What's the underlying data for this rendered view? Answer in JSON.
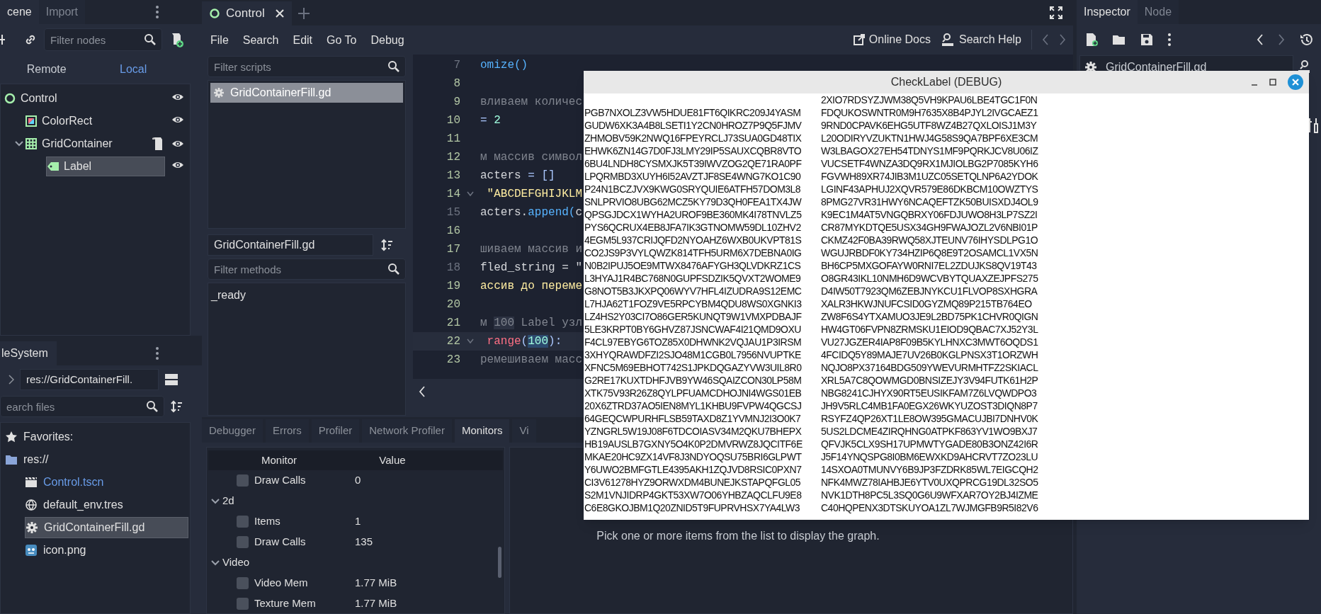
{
  "scene_dock": {
    "tabs": [
      {
        "label": "cene",
        "selected": true
      },
      {
        "label": "Import",
        "selected": false
      }
    ],
    "filter": {
      "placeholder": "Filter nodes"
    },
    "modes": [
      {
        "label": "Remote",
        "selected": false
      },
      {
        "label": "Local",
        "selected": true
      }
    ],
    "tree": [
      {
        "label": "Control",
        "kind": "control",
        "script": false,
        "visible": true,
        "selected": false,
        "children": [
          {
            "label": "ColorRect",
            "kind": "colorrect",
            "script": false,
            "visible": true,
            "selected": false
          },
          {
            "label": "GridContainer",
            "kind": "grid",
            "script": true,
            "visible": true,
            "selected": false,
            "expanded": true,
            "children": [
              {
                "label": "Label",
                "kind": "label",
                "script": false,
                "visible": true,
                "selected": true
              }
            ]
          }
        ]
      }
    ]
  },
  "filesystem": {
    "tab": "leSystem",
    "path": "res://GridContainerFill.",
    "search": {
      "placeholder": "earch files"
    },
    "tree": [
      {
        "label": "Favorites:",
        "kind": "favorites",
        "selected": false,
        "open": false
      },
      {
        "label": "res://",
        "kind": "folder",
        "selected": false,
        "open": false,
        "children": [
          {
            "label": "Control.tscn",
            "kind": "scene",
            "selected": false,
            "open": true
          },
          {
            "label": "default_env.tres",
            "kind": "environment",
            "selected": false,
            "open": false
          },
          {
            "label": "GridContainerFill.gd",
            "kind": "script",
            "selected": true,
            "open": false
          },
          {
            "label": "icon.png",
            "kind": "image",
            "selected": false,
            "open": false
          }
        ]
      }
    ]
  },
  "scene_tabs": [
    {
      "label": "Control",
      "selected": true
    }
  ],
  "menu": [
    "File",
    "Search",
    "Edit",
    "Go To",
    "Debug"
  ],
  "help_links": [
    "Online Docs",
    "Search Help"
  ],
  "script_list": {
    "filter": {
      "placeholder": "Filter scripts"
    },
    "items": [
      {
        "label": "GridContainerFill.gd",
        "selected": true
      }
    ]
  },
  "method_panel": {
    "script_name": "GridContainerFill.gd",
    "filter": {
      "placeholder": "Filter methods"
    },
    "methods": [
      "_ready"
    ]
  },
  "code_lines": [
    {
      "number": "7",
      "safe": false,
      "current": false,
      "segments": [
        {
          "text": "omize()",
          "kind": "func"
        }
      ]
    },
    {
      "number": "8",
      "safe": true,
      "current": false
    },
    {
      "number": "9",
      "safe": true,
      "current": false,
      "segments": [
        {
          "text": "вливаем количес",
          "kind": "comment"
        }
      ]
    },
    {
      "number": "10",
      "safe": true,
      "current": false,
      "segments": [
        {
          "text": "= ",
          "kind": "symbol"
        },
        {
          "text": "2",
          "kind": "number"
        }
      ]
    },
    {
      "number": "11",
      "safe": true,
      "current": false
    },
    {
      "number": "12",
      "safe": true,
      "current": false,
      "segments": [
        {
          "text": "м массив символ",
          "kind": "comment"
        }
      ]
    },
    {
      "number": "13",
      "safe": true,
      "current": false,
      "segments": [
        {
          "text": "acters ",
          "kind": "text"
        },
        {
          "text": "= []",
          "kind": "symbol"
        }
      ]
    },
    {
      "number": "14",
      "safe": true,
      "current": false,
      "fold": true,
      "segments": [
        {
          "text": " \"ABCDEFGHIJKLM",
          "kind": "string"
        }
      ]
    },
    {
      "number": "15",
      "safe": false,
      "current": false,
      "segments": [
        {
          "text": "acters.",
          "kind": "text"
        },
        {
          "text": "append(",
          "kind": "func"
        },
        {
          "text": "c",
          "kind": "text"
        }
      ]
    },
    {
      "number": "16",
      "safe": true,
      "current": false
    },
    {
      "number": "17",
      "safe": true,
      "current": false,
      "segments": [
        {
          "text": "шиваем массив и",
          "kind": "comment"
        }
      ]
    },
    {
      "number": "18",
      "safe": false,
      "current": false,
      "segments": [
        {
          "text": "fled_string = \"",
          "kind": "text"
        }
      ]
    },
    {
      "number": "19",
      "safe": true,
      "current": false,
      "segments": [
        {
          "text": "ассив до переме",
          "kind": "string"
        }
      ]
    },
    {
      "number": "20",
      "safe": true,
      "current": false
    },
    {
      "number": "21",
      "safe": true,
      "current": false,
      "segments": [
        {
          "text": "м ",
          "kind": "comment"
        },
        {
          "text": "100",
          "kind": "comment_match"
        },
        {
          "text": " Label узл",
          "kind": "comment"
        }
      ]
    },
    {
      "number": "22",
      "safe": true,
      "current": true,
      "fold": true,
      "segments": [
        {
          "text": " range",
          "kind": "keyword"
        },
        {
          "text": "(",
          "kind": "symbol"
        },
        {
          "text": "100",
          "kind": "number_match"
        },
        {
          "text": "):",
          "kind": "symbol"
        }
      ]
    },
    {
      "number": "23",
      "safe": true,
      "current": false,
      "segments": [
        {
          "text": "ремешиваем масс",
          "kind": "comment"
        }
      ]
    }
  ],
  "bottom_panel": {
    "tabs": [
      {
        "label": "Debugger",
        "selected": false
      },
      {
        "label": "Errors",
        "selected": false
      },
      {
        "label": "Profiler",
        "selected": false
      },
      {
        "label": "Network Profiler",
        "selected": false
      },
      {
        "label": "Monitors",
        "selected": true
      },
      {
        "label": "Vi",
        "selected": false
      }
    ],
    "monitor_columns": [
      "Monitor",
      "Value"
    ],
    "monitors": [
      {
        "kind": "item",
        "label": "Draw Calls",
        "value": "0",
        "checked": false
      },
      {
        "kind": "group",
        "label": "2d",
        "expanded": true
      },
      {
        "kind": "item",
        "label": "Items",
        "value": "1",
        "checked": false
      },
      {
        "kind": "item",
        "label": "Draw Calls",
        "value": "135",
        "checked": false
      },
      {
        "kind": "group",
        "label": "Video",
        "expanded": true
      },
      {
        "kind": "item",
        "label": "Video Mem",
        "value": "1.77 MiB",
        "checked": false
      },
      {
        "kind": "item",
        "label": "Texture Mem",
        "value": "1.77 MiB",
        "checked": false
      }
    ],
    "graph_hint": "Pick one or more items from the list to display the graph."
  },
  "inspector": {
    "tabs": [
      {
        "label": "Inspector",
        "selected": true
      },
      {
        "label": "Node",
        "selected": false
      }
    ],
    "resource": "GridContainerFill.gd"
  },
  "debug_window": {
    "title": "CheckLabel (DEBUG)",
    "labels": [
      "2XIO7RDSYZJWM38Q5VH9KPAU6LBE4TGC1F0N",
      "PGB7NXOLZ3VW5HDUE81FT6QIKRC209J4YASM",
      "FDQUKOSWNTR0M9H7635X8B4PJYL2IVGCAEZ1",
      "GUDW6XK3A4B8LSETI1Y2CN0HROZ7P9Q5FJMV",
      "9RND0CPAVK6EHG5UTF8WZ4B27QXLOISJ1M3Y",
      "ZHMOBV59K2NWQ16FPEYRCLJ73SUA0GD48TIX",
      "L20ODIRYVZUKTN1HWJ4G58S9QA7BPF6XE3CM",
      "EHWK6ZN14G7D0FJ3LMY29IP5SAUXCQBR8VTO",
      "W3LBAGOX27EH54TDNYS1MF9PQRKJCV8U06IZ",
      "6BU4LNDH8CYSMXJK5T39IWVZOG2QE71RA0PF",
      "VUCSETF4WNZA3DQ9RX1MJIOLBG2P7085KYH6",
      "LPQRMBD3XUYH6I52AVZTJF8SE4WNG7KO1C90",
      "FGVWH89XR74JIB3M1UZC05SETQLNP6A2YDOK",
      "P24N1BCZJVX9KWG0SRYQUIE6ATFH57DOM3L8",
      "LGINF43APHUJ2XQVR579E86DKBCM10OWZTYS",
      "SNLPRVIO8UBG62MCZ5KY79D3QH0FEA1TX4JW",
      "8PMG27VR31HWY6NCAQEFTZK50BUISXDJ4OL9",
      "QPSGJDCX1WYHA2UROF9BE360MK4I78TNVLZ5",
      "K9EC1M4AT5VNGQBRXY06FDJUWO8H3LP7SZ2I",
      "PYS6QCRUX4EB8JFA7IK3GTNOMW59DL10ZHV2",
      "CR87MYKDTQE5USX34GH9FWAJOZL2V6NBI01P",
      "4EGM5L937CRIJQFD2NYOAHZ6WXB0UKVPT81S",
      "CKMZ42F0BA39RWQ58XJTEUNV76IHYSDLPG1O",
      "CO2JS9P3VYLQWZK814TFH5URM6X7DEBNA0IG",
      "WGUJRBDF0KY734HZIP6Q8E9T2OSAMCL1VX5N",
      "N0B2IPUJ5OE9MTWX8476AFYGH3QLVDKRZ1CS",
      "BH6CP5MXGOFAYW0RNI7EL2ZDUJKS8QV19T43",
      "L3HYAJ1R4BC768N0GUPFSDZIK5QVXT2WOME9",
      "O8GR43IKL10NMH6D9WCVBYTQUAXZEJPFS275",
      "G8NOT5B3JKXPQ06WYV7HFL4IZUDRA9S12EMC",
      "D4IW50T7923QM6ZEBJNYKCU1FLVOP8SXHGRA",
      "L7HJA62T1FOZ9VE5RPCYBM4QDU8WS0XGNKI3",
      "XALR3HKWJNUFCSID0GYZMQ89P215TB764EO",
      "LZ4HS2Y03CI7O86GER5KUNQT9W1VMXPDBAJF",
      "ZW8F6S4YTXAMUO3JE9L2BD75PK1CHVR0QIGN",
      "5LE3KRPT0BY6GHVZ87JSNCWAF4I21QMD9OXU",
      "HW4GT06FVPN8ZRMSKU1EIOD9QBAC7XJ52Y3L",
      "F4CL97EBYG6TOZ85X0DHWNK2VQJAU1P3IRSM",
      "VU27JGZER4IAP8F09B5KYLHNXC3MWT6OQDS1",
      "3XHYQRAWDFZI2SJO48M1CGB0L7956NVUPTKE",
      "4FCIDQ5Y89MAJE7UV26B0KGLPNSX3T1ORZWH",
      "XFNC5M69EBHOT742S1JPKDQGAZYVW3UIL8R0",
      "NQJO8PX37164BDG509YWEVURMHTFZ2SKIACL",
      "G2RE17KUXTDHFJVB9YW46SQAIZCON30LP58M",
      "XRL5A7C8QOWMGD0BNSIZEJY3V94FUTK61H2P",
      "XTK75V93R26Z8QYLPFUAMCDHOJNI4WGS01EB",
      "NBG8241CJHYX90RT5EUSIKFAM7Z6LVQWDPO3",
      "20X6ZTRD37AO5IEN8MYL1KHBU9FVPW4QGCSJ",
      "JH9V5RLC4MB1FA0EGX26WKYUZOST3DIQN8P7",
      "64GEQCWPURHFLSB59TAXD8Z1YVMNJ2I3O0K7",
      "RSYFZ4QP26XT1LE8OW395GMACUJBI7DNHV0K",
      "YZNGRL5W19J08F6TDCOIASV34M2QKU7BHEPX",
      "5US2LDCME4ZIRQHNG0ATPKF863YV1WO9BXJ7",
      "HB19AUSLB7GXNY5O4K0P2DMVRWZ8JQCITF6E",
      "QFVJK5CLX9SH17UPMWTYGADE80B3ONZ42I6R",
      "MKAE20HC9ZX14VF8J3NDYOQSU75BRI6GLPWT",
      "J5F14YNQSPG8I0BM6EWXKD9AHCRVT7ZO23LU",
      "Y6UWO2BMFGTLE4395AKH1ZQJVD8RSIC0PXN7",
      "14SXOA0TMUNVY6B9JP3FZDRK85WL7EIGCQH2",
      "CI3V61278HYZ9ORWXDM4BUNEJKSTAPQFGL05",
      "NFK4MWZ78IAHBJE6YTV0UXQPRCG19DL32SO5",
      "S2M1VNJIDRP4GKT53XW7O06YHBZAQCLFU9E8",
      "NVK1DTH8PC5L3SQ0G6U9WFXAR7OY2BJ4IZME",
      "C6E8GKOJBM1Q20ZNID5T9FUPRVHSX7YA4LW3",
      "C40HQPENX3DTSKUYOA1ZL7WJMGFB9R5I82V6"
    ]
  }
}
